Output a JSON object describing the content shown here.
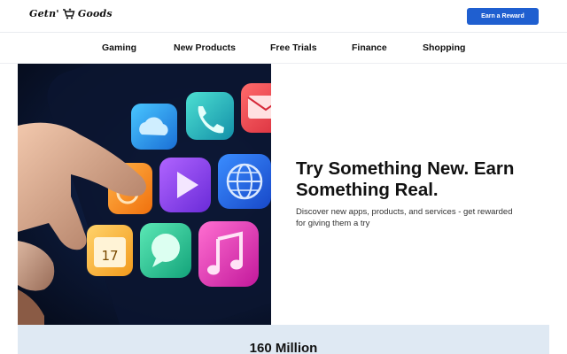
{
  "header": {
    "logo_text_1": "Getn'",
    "logo_text_2": "Goods",
    "cta_label": "Earn a Reward",
    "cta_color": "#1f5fd0"
  },
  "nav": {
    "items": [
      "Gaming",
      "New Products",
      "Free Trials",
      "Finance",
      "Shopping"
    ]
  },
  "hero": {
    "title": "Try Something New. Earn Something Real.",
    "subtitle": "Discover new apps, products, and services - get rewarded for giving them a try",
    "image_icons": [
      "cloud-icon",
      "phone-icon",
      "mail-icon",
      "play-icon",
      "globe-icon",
      "calendar-icon",
      "chat-icon",
      "music-icon"
    ],
    "calendar_number": "17"
  },
  "stats": {
    "headline": "160 Million"
  }
}
